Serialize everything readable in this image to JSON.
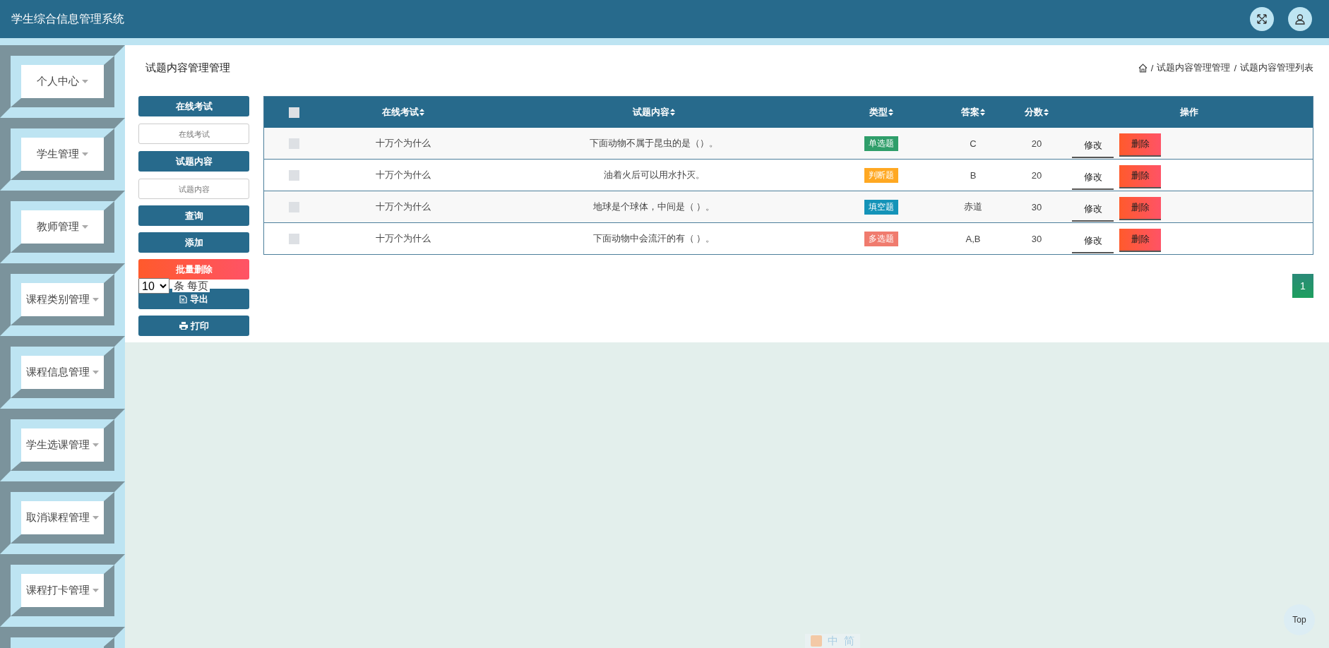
{
  "header": {
    "title": "学生综合信息管理系统"
  },
  "sidebar": {
    "items": [
      {
        "label": "个人中心"
      },
      {
        "label": "学生管理"
      },
      {
        "label": "教师管理"
      },
      {
        "label": "课程类别管理"
      },
      {
        "label": "课程信息管理"
      },
      {
        "label": "学生选课管理"
      },
      {
        "label": "取消课程管理"
      },
      {
        "label": "课程打卡管理"
      }
    ]
  },
  "page": {
    "title": "试题内容管理管理"
  },
  "breadcrumb": [
    {
      "separator": "/",
      "label": "试题内容管理管理"
    },
    {
      "separator": "/",
      "label": "试题内容管理列表"
    }
  ],
  "search": {
    "fields": [
      {
        "label": "在线考试",
        "placeholder": "在线考试"
      },
      {
        "label": "试题内容",
        "placeholder": "试题内容"
      }
    ]
  },
  "actions": [
    {
      "kind": "query",
      "label": "查询"
    },
    {
      "kind": "add",
      "label": "添加"
    },
    {
      "kind": "batch_delete",
      "label": "批量删除"
    },
    {
      "kind": "export",
      "label": "导出"
    },
    {
      "kind": "print",
      "label": "打印"
    }
  ],
  "page_size": {
    "value": "10",
    "suffix": "条 每页"
  },
  "table": {
    "all_checked": false,
    "columns": [
      {
        "label": "在线考试",
        "sortable": true
      },
      {
        "label": "试题内容",
        "sortable": true
      },
      {
        "label": "类型",
        "sortable": true
      },
      {
        "label": "答案",
        "sortable": true
      },
      {
        "label": "分数",
        "sortable": true
      },
      {
        "label": "操作",
        "sortable": false
      }
    ],
    "rows": [
      {
        "checked": false,
        "exam": "十万个为什么",
        "content": "下面动物不属于昆虫的是（）。",
        "type": {
          "label": "单选题",
          "color": "#2f9e6a"
        },
        "answer": "C",
        "score": "20",
        "actions": [
          "修改",
          "删除"
        ]
      },
      {
        "checked": false,
        "exam": "十万个为什么",
        "content": "油着火后可以用水扑灭。",
        "type": {
          "label": "判断题",
          "color": "#ffa822"
        },
        "answer": "B",
        "score": "20",
        "actions": [
          "修改",
          "删除"
        ]
      },
      {
        "checked": false,
        "exam": "十万个为什么",
        "content": "地球是个球体，中间是（ ）。",
        "type": {
          "label": "填空题",
          "color": "#1493b8"
        },
        "answer": "赤道",
        "score": "30",
        "actions": [
          "修改",
          "删除"
        ]
      },
      {
        "checked": false,
        "exam": "十万个为什么",
        "content": "下面动物中会流汗的有（ ）。",
        "type": {
          "label": "多选题",
          "color": "#f07b6e"
        },
        "answer": "A,B",
        "score": "30",
        "actions": [
          "修改",
          "删除"
        ]
      }
    ]
  },
  "pagination": {
    "pages": [
      {
        "label": "1",
        "selected": true
      }
    ]
  },
  "back_to_top": {
    "label": "Top"
  },
  "ime_toolbar": {
    "items": [
      "中",
      "简"
    ]
  }
}
